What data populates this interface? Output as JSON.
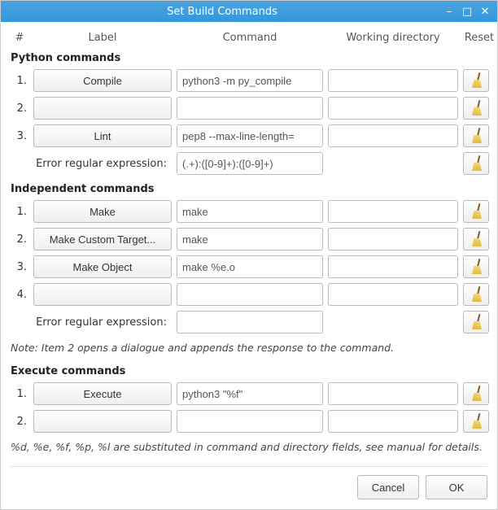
{
  "window": {
    "title": "Set Build Commands"
  },
  "headers": {
    "num": "#",
    "label": "Label",
    "command": "Command",
    "wd": "Working directory",
    "reset": "Reset"
  },
  "sections": {
    "python": "Python commands",
    "independent": "Independent commands",
    "execute": "Execute commands"
  },
  "regex_label": "Error regular expression:",
  "python_rows": [
    {
      "num": "1.",
      "label": "Compile",
      "command": "python3 -m py_compile",
      "wd": ""
    },
    {
      "num": "2.",
      "label": "",
      "command": "",
      "wd": ""
    },
    {
      "num": "3.",
      "label": "Lint",
      "command": "pep8 --max-line-length=",
      "wd": ""
    }
  ],
  "python_regex": "(.+):([0-9]+):([0-9]+)",
  "independent_rows": [
    {
      "num": "1.",
      "label": "Make",
      "command": "make",
      "wd": ""
    },
    {
      "num": "2.",
      "label": "Make Custom Target...",
      "command": "make",
      "wd": ""
    },
    {
      "num": "3.",
      "label": "Make Object",
      "command": "make %e.o",
      "wd": ""
    },
    {
      "num": "4.",
      "label": "",
      "command": "",
      "wd": ""
    }
  ],
  "independent_regex": "",
  "note_independent": "Note: Item 2 opens a dialogue and appends the response to the command.",
  "execute_rows": [
    {
      "num": "1.",
      "label": "Execute",
      "command": "python3 \"%f\"",
      "wd": ""
    },
    {
      "num": "2.",
      "label": "",
      "command": "",
      "wd": ""
    }
  ],
  "note_execute": "%d, %e, %f, %p, %l are substituted in command and directory fields, see manual for details.",
  "buttons": {
    "cancel": "Cancel",
    "ok": "OK"
  }
}
